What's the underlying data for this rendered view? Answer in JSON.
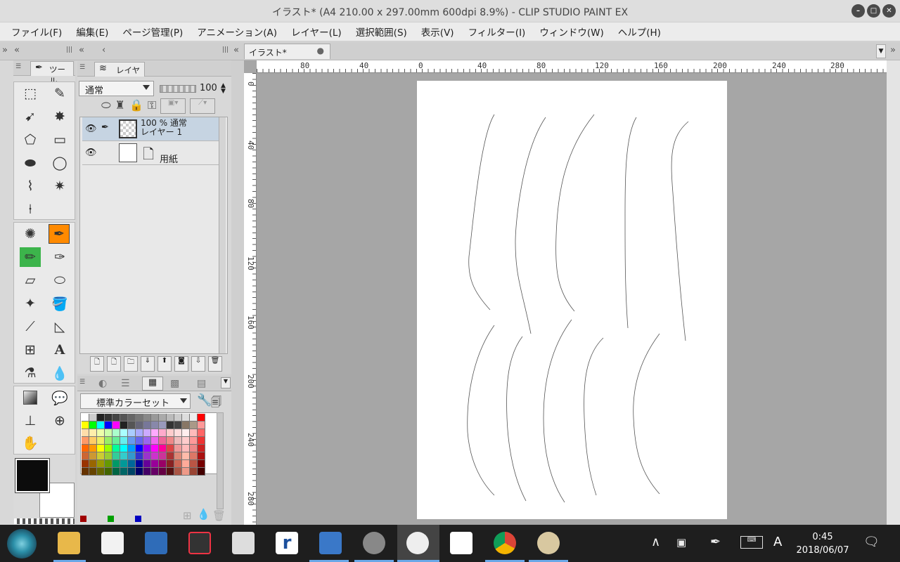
{
  "window": {
    "title": "イラスト* (A4 210.00 x 297.00mm 600dpi 8.9%)  - CLIP STUDIO PAINT EX"
  },
  "menu": [
    "ファイル(F)",
    "編集(E)",
    "ページ管理(P)",
    "アニメーション(A)",
    "レイヤー(L)",
    "選択範囲(S)",
    "表示(V)",
    "フィルター(I)",
    "ウィンドウ(W)",
    "ヘルプ(H)"
  ],
  "document_tab": {
    "label": "イラスト*",
    "modified_marker": "●"
  },
  "tool_panel": {
    "tab_label": "ツール"
  },
  "layer_panel": {
    "tab_label": "レイヤー",
    "blend_mode": "通常",
    "opacity": "100",
    "layers": [
      {
        "line1": "100 % 通常",
        "line2": "レイヤー 1",
        "selected": true
      },
      {
        "line1": "",
        "line2": "用紙",
        "selected": false
      }
    ]
  },
  "color_panel": {
    "set_name": "標準カラーセット",
    "recent_colors": [
      "#a00000",
      "#00a000",
      "#0000c0"
    ]
  },
  "ruler": {
    "h_ticks": [
      "80",
      "40",
      "0",
      "40",
      "80",
      "120",
      "160",
      "200",
      "240",
      "280"
    ],
    "v_ticks": [
      "0",
      "40",
      "80",
      "120",
      "160",
      "200",
      "240",
      "280"
    ]
  },
  "colors": {
    "foreground": "#0c0c0c",
    "background": "#ffffff",
    "accent_tool": "#ff8a00"
  },
  "taskbar": {
    "time": "0:45",
    "date": "2018/06/07",
    "ime": "A",
    "apps": [
      "file-explorer",
      "store",
      "news",
      "photoscape",
      "remote",
      "r-app",
      "5-app",
      "clip-studio-launcher",
      "clip-studio-paint",
      "dictionary",
      "chrome",
      "paint"
    ]
  }
}
